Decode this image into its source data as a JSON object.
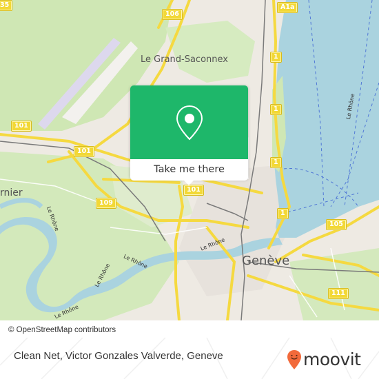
{
  "map": {
    "place_labels": [
      {
        "name": "Le Grand-Saconnex"
      },
      {
        "name": "Genève"
      },
      {
        "name": "rnier"
      }
    ],
    "river_labels": [
      "Le Rhône",
      "Le Rhône",
      "Le Rhône",
      "Le Rhône",
      "Le Rhône",
      "Le Rhône"
    ],
    "road_shields": [
      "106",
      "A1a",
      "35",
      "1",
      "1",
      "1",
      "1",
      "101",
      "101",
      "101",
      "109",
      "105",
      "111"
    ],
    "colors": {
      "land": "#eeeae3",
      "park": "#cde8b0",
      "water": "#aad3df",
      "major_road": "#f7dc4a",
      "runway": "#ddd8ee",
      "rail": "#777777"
    }
  },
  "popup": {
    "button_label": "Take me there",
    "icon": "location-pin-icon",
    "color": "#1eb76a"
  },
  "attribution": {
    "text": "© OpenStreetMap contributors"
  },
  "footer": {
    "title": "Clean Net, Victor Gonzales Valverde, Geneve",
    "brand": "moovit",
    "brand_color": "#f26a3b"
  }
}
